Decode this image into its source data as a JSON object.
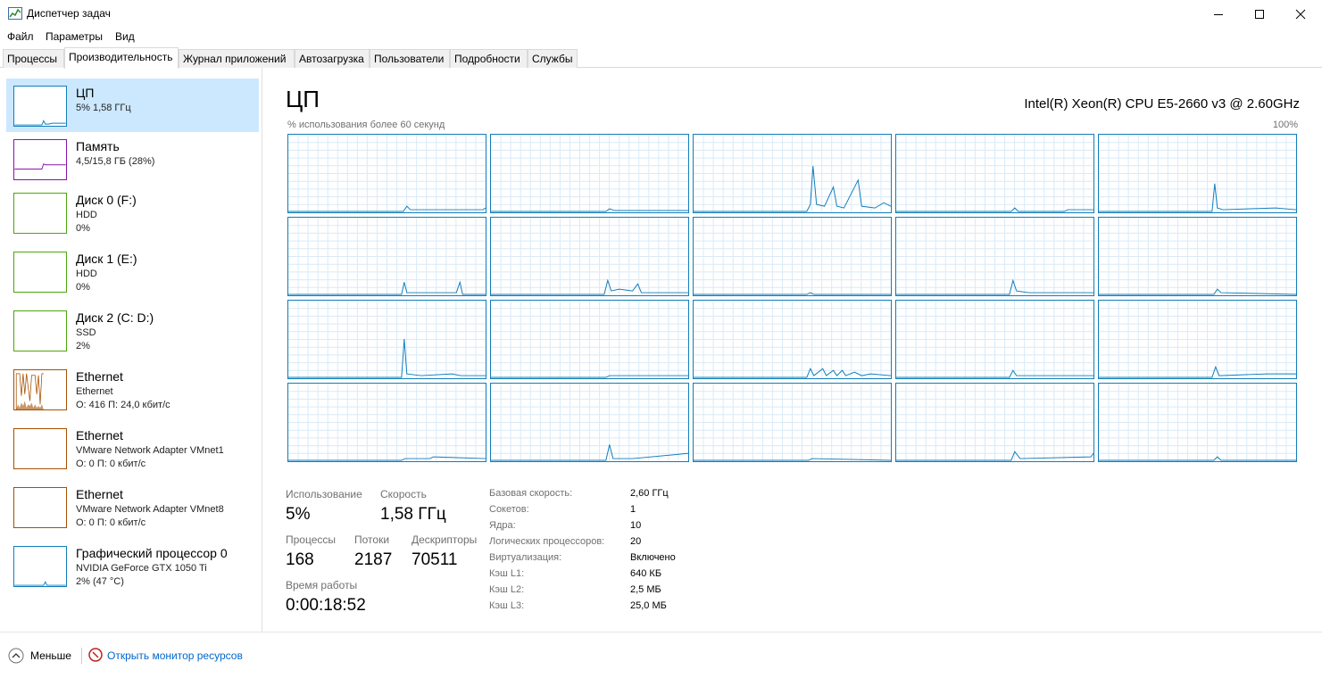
{
  "window": {
    "title": "Диспетчер задач",
    "icons": {
      "app": "task-manager-icon",
      "minimize": "minimize-icon",
      "maximize": "maximize-icon",
      "close": "close-icon"
    }
  },
  "menu": [
    "Файл",
    "Параметры",
    "Вид"
  ],
  "tabs": [
    "Процессы",
    "Производительность",
    "Журнал приложений",
    "Автозагрузка",
    "Пользователи",
    "Подробности",
    "Службы"
  ],
  "active_tab": "Производительность",
  "sidebar": [
    {
      "title": "ЦП",
      "line1": "5%  1,58 ГГц",
      "line2": "",
      "color": "#117dbb"
    },
    {
      "title": "Память",
      "line1": "4,5/15,8 ГБ (28%)",
      "line2": "",
      "color": "#8b12ae"
    },
    {
      "title": "Диск 0 (F:)",
      "line1": "HDD",
      "line2": "0%",
      "color": "#4da60c"
    },
    {
      "title": "Диск 1 (E:)",
      "line1": "HDD",
      "line2": "0%",
      "color": "#4da60c"
    },
    {
      "title": "Диск 2 (C: D:)",
      "line1": "SSD",
      "line2": "2%",
      "color": "#4da60c"
    },
    {
      "title": "Ethernet",
      "line1": "Ethernet",
      "line2": "О: 416  П: 24,0 кбит/с",
      "color": "#a74f01"
    },
    {
      "title": "Ethernet",
      "line1": "VMware Network Adapter VMnet1",
      "line2": "О: 0  П: 0 кбит/с",
      "color": "#a74f01"
    },
    {
      "title": "Ethernet",
      "line1": "VMware Network Adapter VMnet8",
      "line2": "О: 0  П: 0 кбит/с",
      "color": "#a74f01"
    },
    {
      "title": "Графический процессор 0",
      "line1": "NVIDIA GeForce GTX 1050 Ti",
      "line2": "2% (47 °C)",
      "color": "#117dbb"
    }
  ],
  "main": {
    "title": "ЦП",
    "cpu_name": "Intel(R) Xeon(R) CPU E5-2660 v3 @ 2.60GHz",
    "graph_caption": "% использования более 60 секунд",
    "graph_max": "100%",
    "graph_color": "#117dbb",
    "stats": {
      "usage_label": "Использование",
      "usage_value": "5%",
      "speed_label": "Скорость",
      "speed_value": "1,58 ГГц",
      "processes_label": "Процессы",
      "processes_value": "168",
      "threads_label": "Потоки",
      "threads_value": "2187",
      "handles_label": "Дескрипторы",
      "handles_value": "70511",
      "uptime_label": "Время работы",
      "uptime_value": "0:00:18:52"
    },
    "details": [
      {
        "key": "Базовая скорость:",
        "value": "2,60 ГГц"
      },
      {
        "key": "Сокетов:",
        "value": "1"
      },
      {
        "key": "Ядра:",
        "value": "10"
      },
      {
        "key": "Логических процессоров:",
        "value": "20"
      },
      {
        "key": "Виртуализация:",
        "value": "Включено"
      },
      {
        "key": "Кэш L1:",
        "value": "640 КБ"
      },
      {
        "key": "Кэш L2:",
        "value": "2,5 МБ"
      },
      {
        "key": "Кэш L3:",
        "value": "25,0 МБ"
      }
    ]
  },
  "footer": {
    "less_label": "Меньше",
    "monitor_label": "Открыть монитор ресурсов",
    "icons": {
      "less": "chevron-up-icon",
      "monitor": "resource-monitor-icon"
    }
  }
}
